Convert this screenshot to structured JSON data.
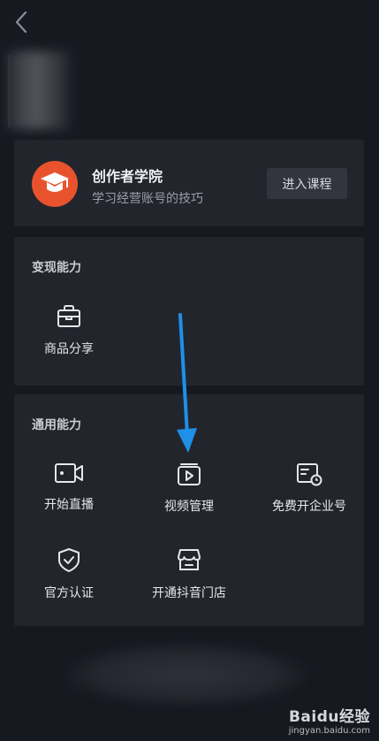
{
  "header": {
    "back_icon": "chevron-left-icon"
  },
  "creator_academy": {
    "title": "创作者学院",
    "subtitle": "学习经营账号的技巧",
    "button_label": "进入课程",
    "icon": "graduation-cap-icon",
    "icon_bg": "#e8532d"
  },
  "monetization": {
    "title": "变现能力",
    "items": [
      {
        "label": "商品分享",
        "icon": "shopping-bag-icon"
      }
    ]
  },
  "general": {
    "title": "通用能力",
    "items": [
      {
        "label": "开始直播",
        "icon": "live-camera-icon"
      },
      {
        "label": "视频管理",
        "icon": "video-manage-icon"
      },
      {
        "label": "免费开企业号",
        "icon": "enterprise-account-icon"
      },
      {
        "label": "官方认证",
        "icon": "shield-check-icon"
      },
      {
        "label": "开通抖音门店",
        "icon": "store-icon"
      }
    ]
  },
  "annotation": {
    "arrow_color": "#1e90e8"
  },
  "watermark": {
    "brand": "Baidu经验",
    "url": "jingyan.baidu.com"
  }
}
